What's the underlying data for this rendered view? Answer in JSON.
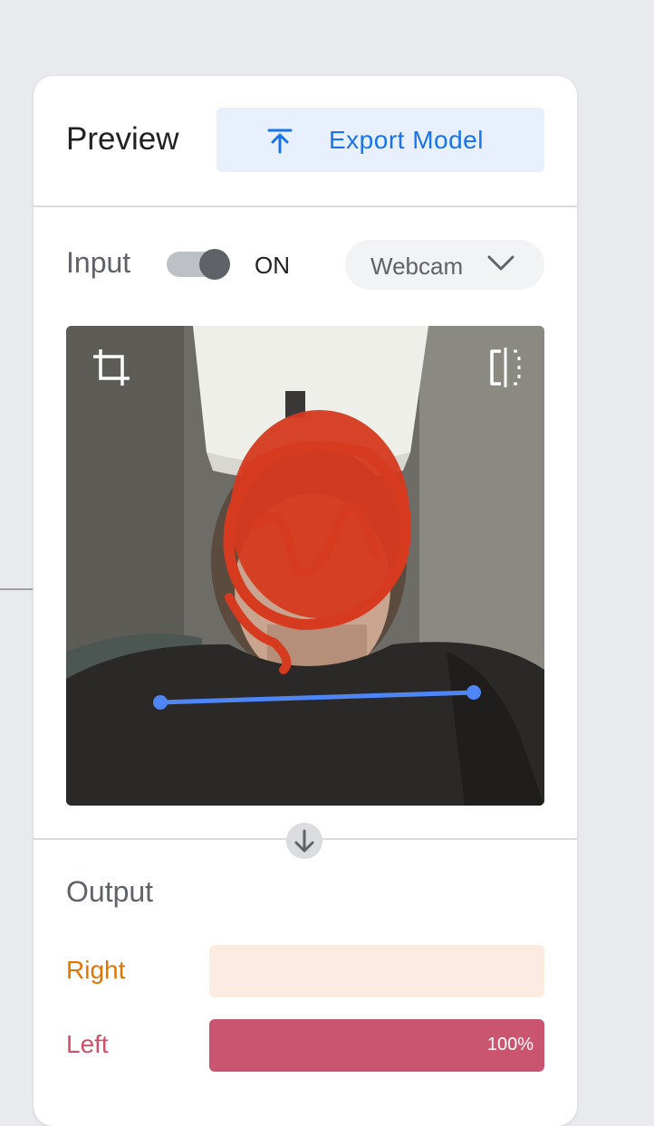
{
  "preview": {
    "title": "Preview",
    "export_label": "Export Model"
  },
  "input": {
    "label": "Input",
    "toggle_state": "ON",
    "toggle_on": true,
    "source": "Webcam"
  },
  "output": {
    "title": "Output",
    "classes": [
      {
        "label": "Right",
        "confidence": 0.0,
        "percent_text": "",
        "label_color": "#e37400",
        "bar_bg": "#fcebe0",
        "bar_color": "#f5a868"
      },
      {
        "label": "Left",
        "confidence": 1.0,
        "percent_text": "100%",
        "label_color": "#d0506a",
        "bar_bg": "#f9e0e5",
        "bar_color": "#c95570"
      }
    ]
  },
  "colors": {
    "accent": "#1a73e8",
    "pose_line": "#4f86f7",
    "redaction": "#d63a1f"
  },
  "icons": {
    "export": "upload-icon",
    "crop": "crop-icon",
    "flip": "flip-icon",
    "dropdown": "chevron-down-icon",
    "step": "arrow-down-icon"
  }
}
